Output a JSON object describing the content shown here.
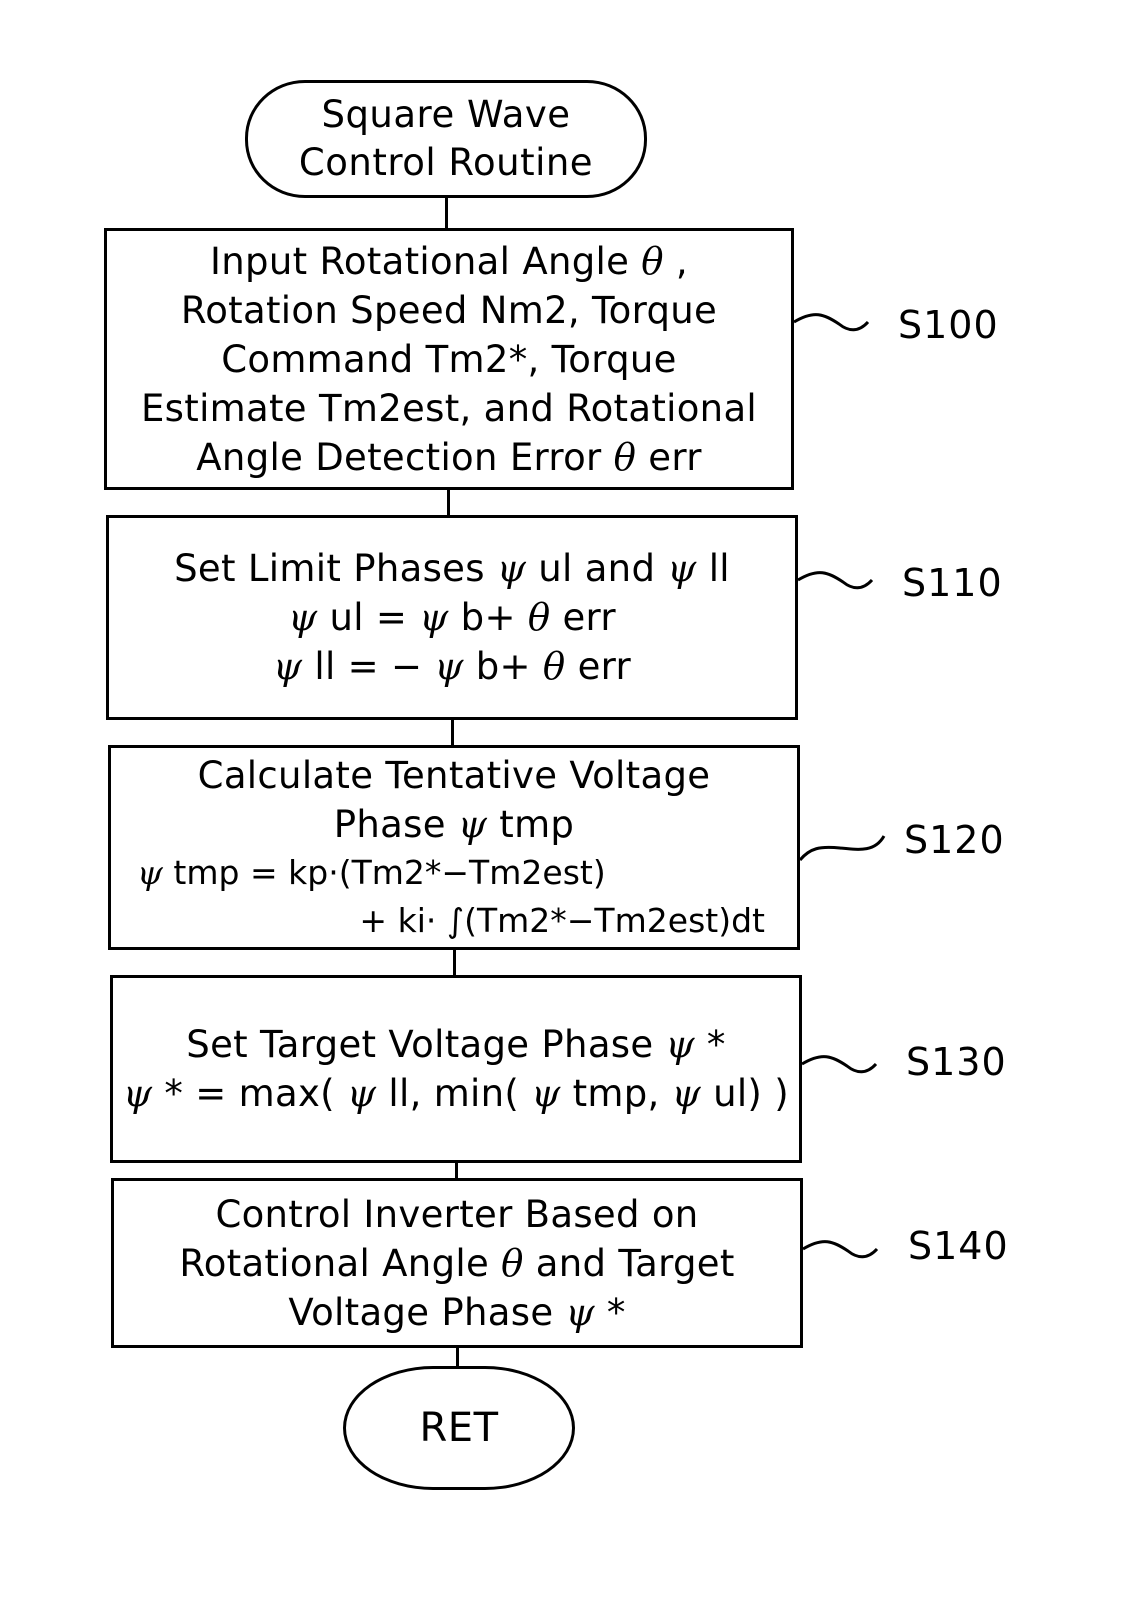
{
  "diagram": {
    "start": {
      "lines": [
        "Square Wave",
        "Control Routine"
      ]
    },
    "steps": [
      {
        "id": "S100",
        "lines": [
          "Input Rotational Angle θ ,",
          "Rotation Speed Nm2, Torque",
          "Command Tm2*, Torque",
          "Estimate Tm2est, and Rotational",
          "Angle Detection Error θ err"
        ]
      },
      {
        "id": "S110",
        "lines": [
          "Set Limit Phases ψ ul and ψ ll",
          "ψ ul = ψ b+ θ err",
          "ψ ll = − ψ b+ θ err"
        ]
      },
      {
        "id": "S120",
        "lines": [
          "Calculate Tentative Voltage",
          "Phase ψ tmp",
          "ψ tmp = kp·(Tm2*−Tm2est)",
          "+ ki· ∫(Tm2*−Tm2est)dt"
        ]
      },
      {
        "id": "S130",
        "lines": [
          "Set Target Voltage Phase ψ *",
          "ψ * = max( ψ ll,  min( ψ tmp, ψ ul) )"
        ]
      },
      {
        "id": "S140",
        "lines": [
          "Control Inverter Based on",
          "Rotational Angle θ and Target",
          "Voltage Phase ψ *"
        ]
      }
    ],
    "end": {
      "label": "RET"
    }
  }
}
